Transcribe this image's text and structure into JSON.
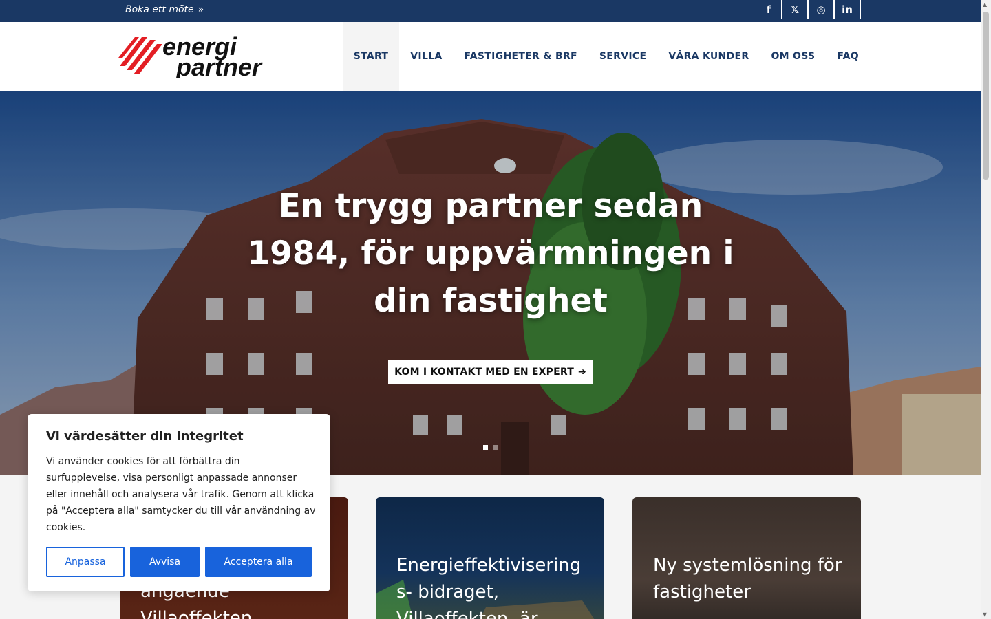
{
  "topbar": {
    "book_label": "Boka ett möte",
    "book_chevron": "»",
    "social": [
      {
        "icon": "facebook-icon",
        "glyph": "f"
      },
      {
        "icon": "x-icon",
        "glyph": "𝕏"
      },
      {
        "icon": "instagram-icon",
        "glyph": "◎"
      },
      {
        "icon": "linkedin-icon",
        "glyph": "in"
      }
    ]
  },
  "header": {
    "logo_line1": "energi",
    "logo_line2": "partner",
    "nav": [
      "START",
      "VILLA",
      "FASTIGHETER & BRF",
      "SERVICE",
      "VÅRA KUNDER",
      "OM OSS",
      "FAQ"
    ],
    "active_nav": "START"
  },
  "hero": {
    "title": "En trygg partner sedan 1984, för uppvärmningen i din fastighet",
    "cta": "KOM I KONTAKT MED EN EXPERT",
    "cta_arrow": "➔"
  },
  "cards": [
    {
      "text": "angående Villaoffekten"
    },
    {
      "text": "Energieffektivisering s- bidraget, Villaoffekten, är"
    },
    {
      "text": "Ny systemlösning för fastigheter"
    }
  ],
  "cookie": {
    "title": "Vi värdesätter din integritet",
    "body": "Vi använder cookies för att förbättra din surfupplevelse, visa personligt anpassade annonser eller innehåll och analysera vår trafik. Genom att klicka på \"Acceptera alla\" samtycker du till vår användning av cookies.",
    "customize": "Anpassa",
    "reject": "Avvisa",
    "accept": "Acceptera alla"
  },
  "colors": {
    "brand_navy": "#1a3864",
    "logo_red": "#e31e24",
    "cookie_blue": "#1863dc"
  }
}
